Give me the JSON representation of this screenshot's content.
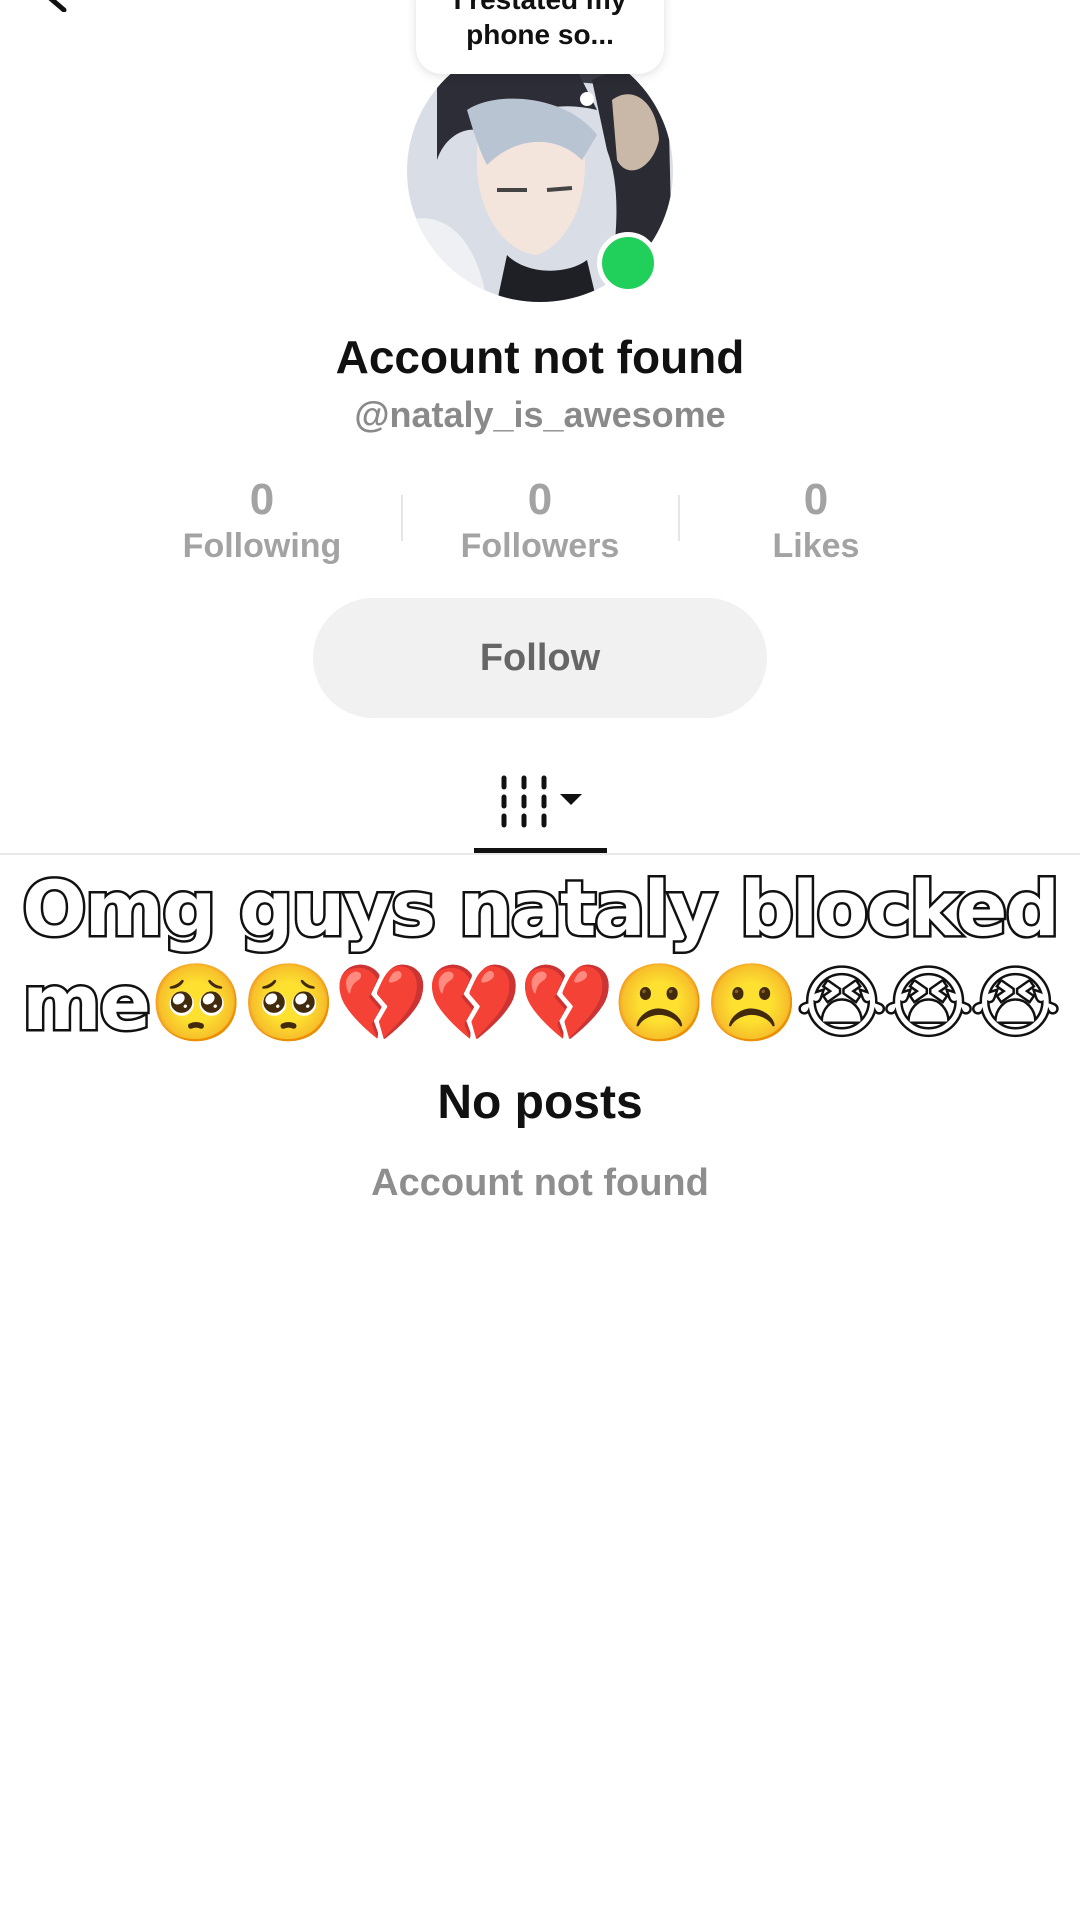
{
  "note_bubble": {
    "text": "I restated my phone so..."
  },
  "profile": {
    "name": "Account not found",
    "handle": "@nataly_is_awesome",
    "online_color": "#20d05a"
  },
  "stats": [
    {
      "value": "0",
      "label": "Following"
    },
    {
      "value": "0",
      "label": "Followers"
    },
    {
      "value": "0",
      "label": "Likes"
    }
  ],
  "follow_button": {
    "label": "Follow"
  },
  "tabs": {
    "active": "videos-grid-icon",
    "dropdown_icon": "caret-down-icon"
  },
  "caption": {
    "line1": "Omg guys nataly blocked",
    "line2": "me🥺🥺💔💔💔☹️☹️😭😭😭"
  },
  "empty_state": {
    "title": "No posts",
    "subtitle": "Account not found"
  }
}
